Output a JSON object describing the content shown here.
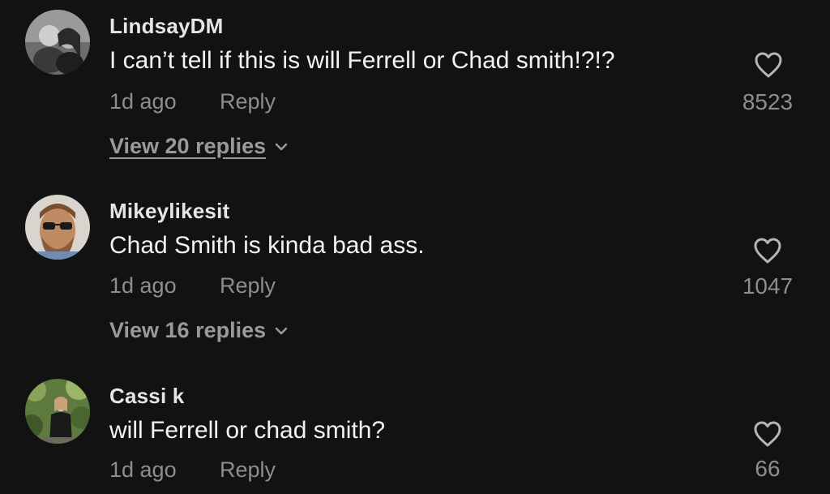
{
  "comments": [
    {
      "username": "LindsayDM",
      "text": "I can’t tell if this is will Ferrell or Chad smith!?!?",
      "time": "1d ago",
      "reply_label": "Reply",
      "likes": "8523",
      "view_replies": "View 20 replies"
    },
    {
      "username": "Mikeylikesit",
      "text": "Chad Smith is kinda bad ass.",
      "time": "1d ago",
      "reply_label": "Reply",
      "likes": "1047",
      "view_replies": "View 16 replies"
    },
    {
      "username": "Cassi k",
      "text": "will Ferrell or chad smith?",
      "time": "1d ago",
      "reply_label": "Reply",
      "likes": "66"
    }
  ],
  "icons": {
    "like": "heart-outline-icon",
    "expand": "chevron-down-icon"
  },
  "colors": {
    "background": "#121212",
    "username": "#e6e6e6",
    "text": "#f2f2f2",
    "muted": "#8e8e8e"
  }
}
